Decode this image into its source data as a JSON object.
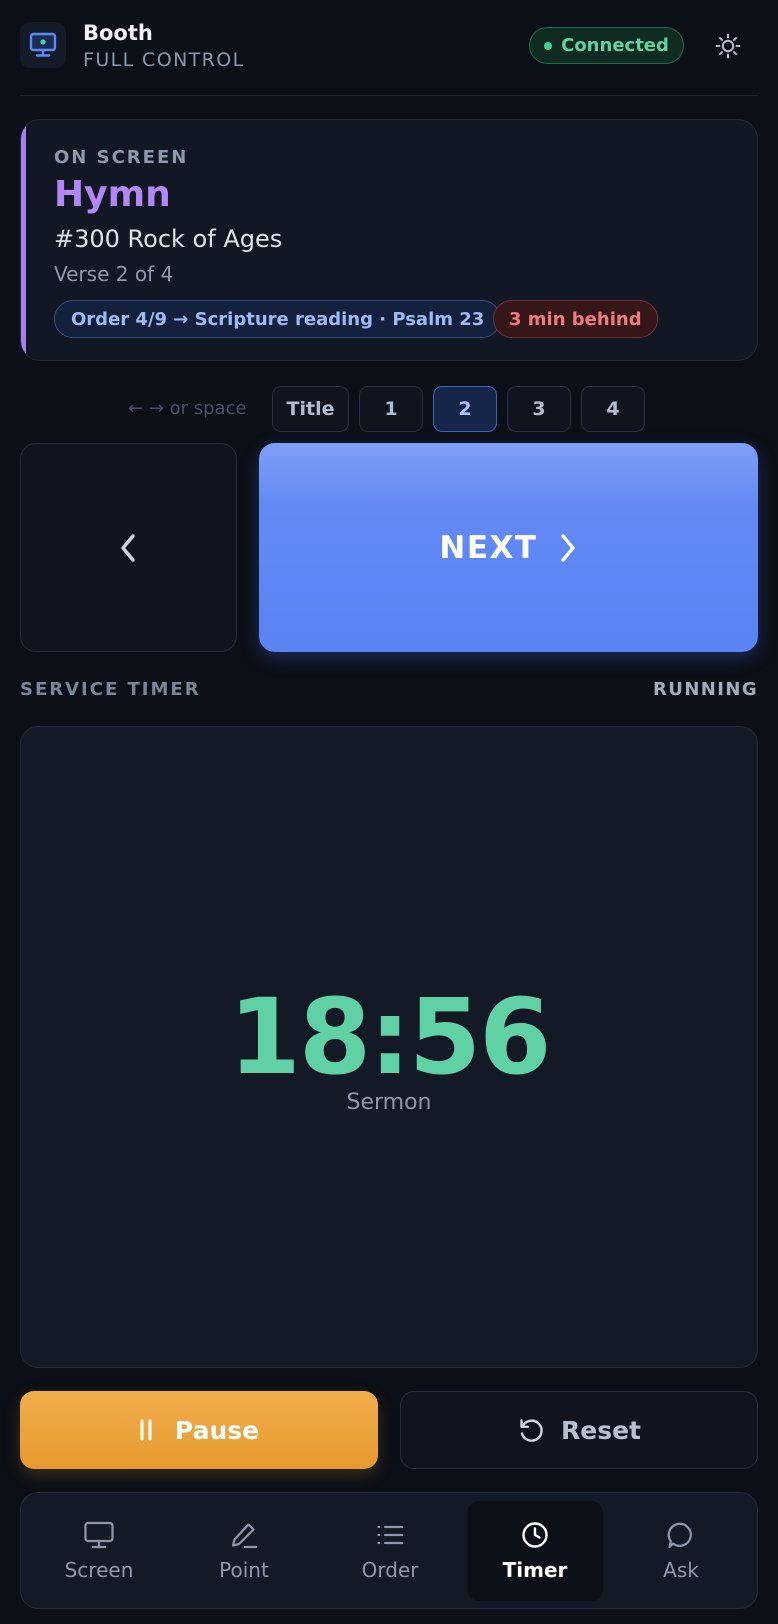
{
  "header": {
    "title": "Booth",
    "subtitle": "FULL CONTROL",
    "status": "Connected",
    "icons": {
      "app": "monitor-icon",
      "theme": "sun-icon"
    }
  },
  "on_screen": {
    "label": "ON SCREEN",
    "type": "Hymn",
    "song": "#300 Rock of Ages",
    "verse": "Verse 2 of 4",
    "order_badge": "Order 4/9 → Scripture reading · Psalm 23",
    "behind_badge": "3 min behind"
  },
  "verse_nav": {
    "hint": "← → or space",
    "buttons": [
      "Title",
      "1",
      "2",
      "3",
      "4"
    ],
    "active": "2"
  },
  "controls": {
    "next_label": "NEXT",
    "prev_icon": "chevron-left-icon",
    "next_icon": "chevron-right-icon"
  },
  "timer": {
    "section_label": "SERVICE TIMER",
    "state": "RUNNING",
    "value": "18:56",
    "segment": "Sermon",
    "pause_label": "Pause",
    "reset_label": "Reset"
  },
  "nav": {
    "items": [
      {
        "label": "Screen",
        "icon": "monitor-icon"
      },
      {
        "label": "Point",
        "icon": "pen-icon"
      },
      {
        "label": "Order",
        "icon": "list-icon"
      },
      {
        "label": "Timer",
        "icon": "clock-icon"
      },
      {
        "label": "Ask",
        "icon": "chat-bubble-icon"
      }
    ],
    "active": "Timer"
  },
  "colors": {
    "background": "#0b0f17",
    "accent_purple": "#b387f5",
    "next_blue": "#5a84f3",
    "timer_green": "#5fd1a4",
    "pause_orange": "#e69a2e",
    "connected_green": "#5fd3a1",
    "behind_red": "#f37b7d"
  }
}
